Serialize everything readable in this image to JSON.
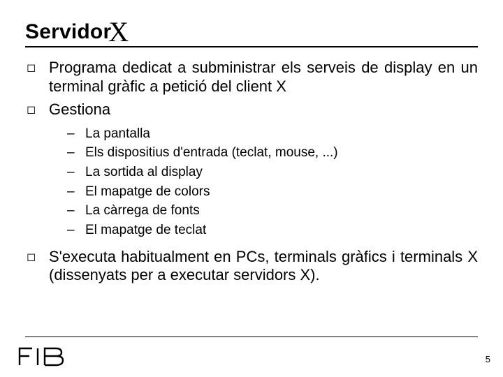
{
  "title": {
    "prefix": "Servidor",
    "suffix": "X"
  },
  "bullets": [
    {
      "text": "Programa dedicat a subministrar els serveis de display en un terminal gràfic a petició del client X"
    },
    {
      "text": "Gestiona"
    },
    {
      "text": "S'executa habitualment en PCs, terminals gràfics i terminals X (dissenyats per a executar servidors X)."
    }
  ],
  "subitems": [
    "La pantalla",
    "Els dispositius d'entrada (teclat, mouse, ...)",
    "La sortida al display",
    "El mapatge de colors",
    "La càrrega de fonts",
    "El mapatge de teclat"
  ],
  "page_number": "5",
  "logo_text": "FIB"
}
